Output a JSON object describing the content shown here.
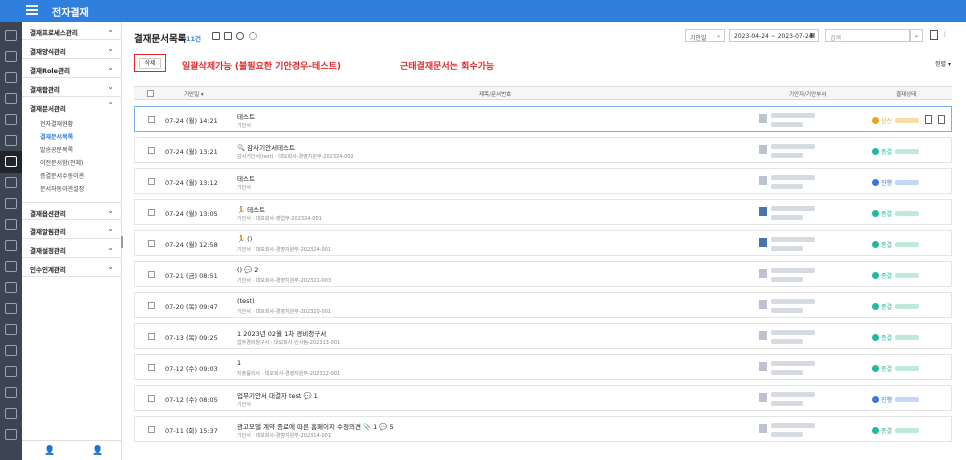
{
  "app": {
    "title": "전자결재"
  },
  "rail": {
    "icons": [
      "home-icon",
      "calculator-icon",
      "document-icon",
      "calendar-icon",
      "document-icon",
      "mail-icon",
      "pen-icon",
      "pencil-icon",
      "bell-icon",
      "mail-icon",
      "calendar-icon",
      "calendar-icon",
      "clipboard-icon",
      "org-icon",
      "monitor-icon",
      "printer-icon",
      "tablet-icon",
      "clipboard-icon",
      "id-icon",
      "building-icon"
    ]
  },
  "sidebar": {
    "groups": [
      {
        "label": "결재프로세스관리",
        "chev": "⌄"
      },
      {
        "label": "결재양식관리",
        "chev": "⌄"
      },
      {
        "label": "결재Role관리",
        "chev": "⌄"
      },
      {
        "label": "결재함관리",
        "chev": "⌄"
      },
      {
        "label": "결재문서관리",
        "chev": "⌃"
      },
      {
        "label": "결재옵션관리",
        "chev": "⌄"
      },
      {
        "label": "결재알림관리",
        "chev": "⌄"
      },
      {
        "label": "결재설정관리",
        "chev": "⌄"
      },
      {
        "label": "인수인계관리",
        "chev": "⌄"
      }
    ],
    "sub_items": [
      "전자결재현황",
      "결재문서목록",
      "발송공문목록",
      "이전문서함(전체)",
      "증결문서수동이관",
      "문서자동이관설정"
    ]
  },
  "main": {
    "title": "결재문서목록",
    "count": "11건",
    "filter_type": "기안일",
    "date_range": "2023-04-24 ~ 2023-07-24",
    "search_placeholder": "검색",
    "delete_label": "삭제",
    "note1": "일괄삭제가능 (불필요한 기안경우-테스트)",
    "note2": "근태결재문서는 회수가능",
    "sort_label": "정렬"
  },
  "table": {
    "headers": {
      "date": "기안일 ▾",
      "title": "제목/문서번호",
      "drafter": "기안자/기안부서",
      "status": "결재상태"
    },
    "rows": [
      {
        "date": "07-24 (월) 14:21",
        "title": "테스트",
        "sub": "기안서",
        "status": "상신",
        "status_color": "#f0a41a",
        "highlight": true
      },
      {
        "date": "07-24 (월) 13:21",
        "title": "🔍 감사기안서테스트",
        "sub": "감사기안서(test) · 대모회사-경영지원부-202324-002",
        "status": "종결",
        "status_color": "#20b99b"
      },
      {
        "date": "07-24 (월) 13:12",
        "title": "테스트",
        "sub": "기안서",
        "status": "진행",
        "status_color": "#3a78d8"
      },
      {
        "date": "07-24 (월) 13:05",
        "title": "🏃 테스트",
        "sub": "기안서 · 대모회사-영업부-202324-001",
        "status": "종결",
        "status_color": "#20b99b"
      },
      {
        "date": "07-24 (월) 12:58",
        "title": "🏃 ()",
        "sub": "기안서 · 대모회사-경영지원부-202324-001",
        "status": "종결",
        "status_color": "#20b99b"
      },
      {
        "date": "07-21 (금) 08:51",
        "title": "() 💬 2",
        "sub": "기안서 · 대모회사-경영지원부-202321-003",
        "status": "종결",
        "status_color": "#20b99b"
      },
      {
        "date": "07-20 (목) 09:47",
        "title": "(test)",
        "sub": "기안서 · 대모회사-경영지원부-202320-001",
        "status": "종결",
        "status_color": "#20b99b"
      },
      {
        "date": "07-13 (목) 09:25",
        "title": "1 2023년 02월 1차 경비청구서",
        "sub": "업무경비청구서 · 대모회사-인사팀-202313-001",
        "status": "종결",
        "status_color": "#20b99b"
      },
      {
        "date": "07-12 (수) 09:03",
        "title": "1",
        "sub": "지출품의서 · 대모회사-경영지원부-202312-001",
        "status": "종결",
        "status_color": "#20b99b"
      },
      {
        "date": "07-12 (수) 08:05",
        "title": "업무기안서 대결자 test 💬 1",
        "sub": "기안서",
        "status": "진행",
        "status_color": "#3a78d8"
      },
      {
        "date": "07-11 (화) 15:37",
        "title": "광고모델 계약 종료에 따른 홈페이지 수정의견 📎 1 💬 5",
        "sub": "기안서 · 대모회사-경영지원부-202314-001",
        "status": "종결",
        "status_color": "#20b99b"
      }
    ]
  }
}
